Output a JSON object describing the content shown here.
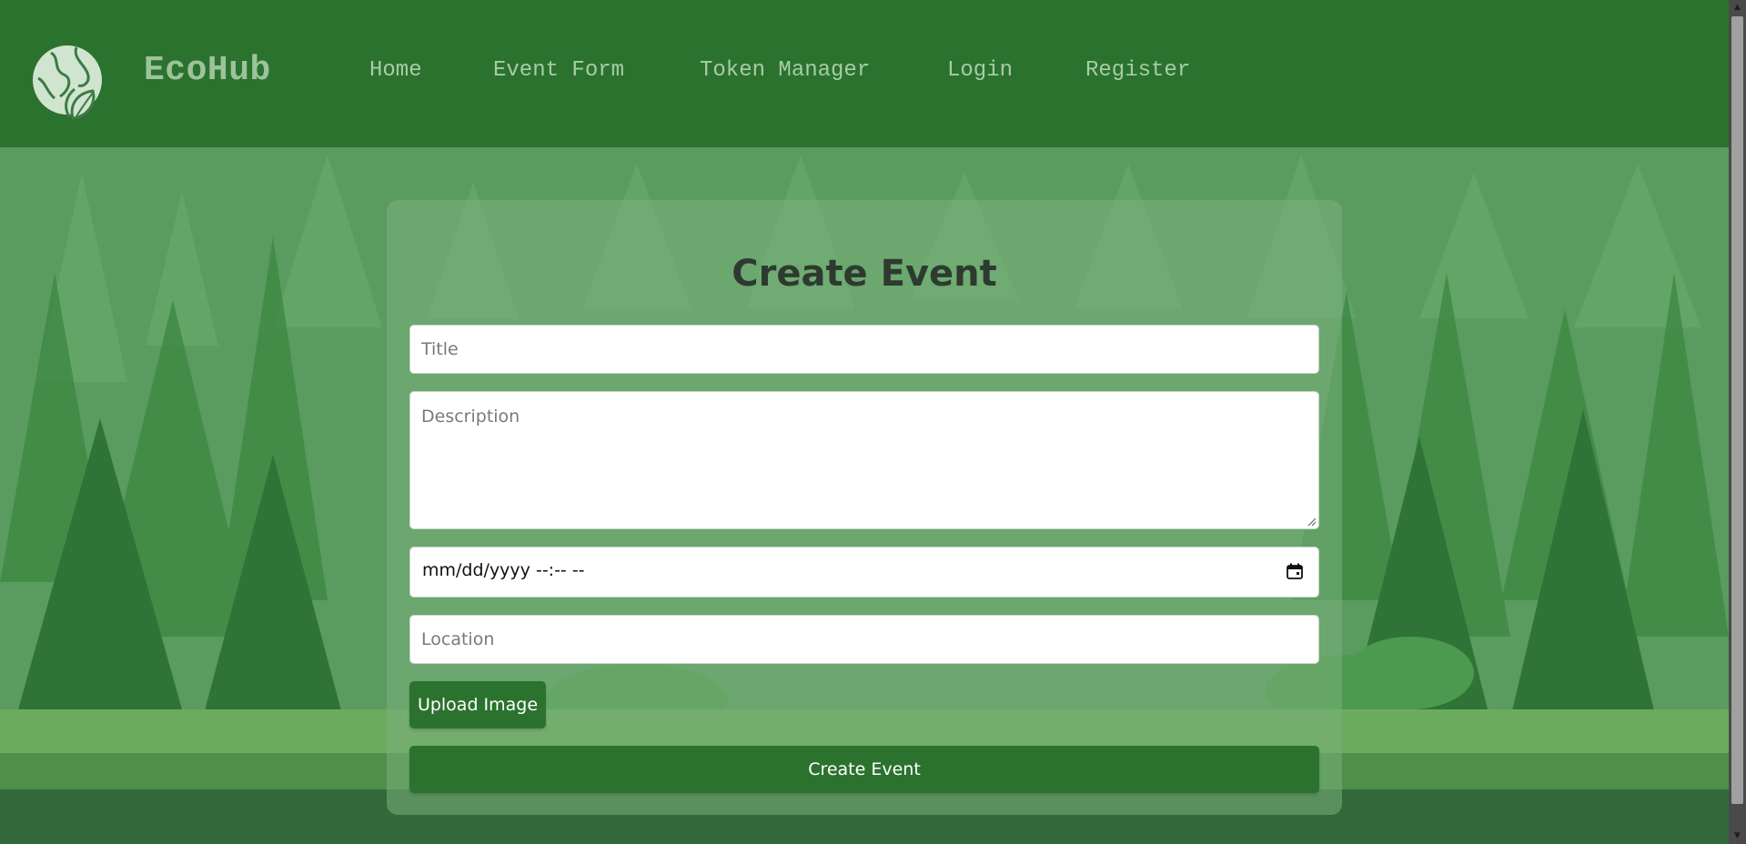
{
  "header": {
    "brand": "EcoHub",
    "nav": [
      {
        "label": "Home"
      },
      {
        "label": "Event Form"
      },
      {
        "label": "Token Manager"
      },
      {
        "label": "Login"
      },
      {
        "label": "Register"
      }
    ]
  },
  "form": {
    "title": "Create Event",
    "title_placeholder": "Title",
    "description_placeholder": "Description",
    "datetime_display": "mm/dd/yyyy --:-- --",
    "location_placeholder": "Location",
    "upload_label": "Upload Image",
    "submit_label": "Create Event"
  },
  "icons": {
    "logo": "globe-leaf-logo",
    "calendar": "calendar-icon",
    "resize": "resize-grip-icon"
  },
  "colors": {
    "header_bg": "#2b722e",
    "nav_text": "#a8cca6",
    "button_bg": "#2b722e",
    "card_bg": "rgba(122,176,124,0.55)",
    "title_text": "#2e3a2f"
  }
}
